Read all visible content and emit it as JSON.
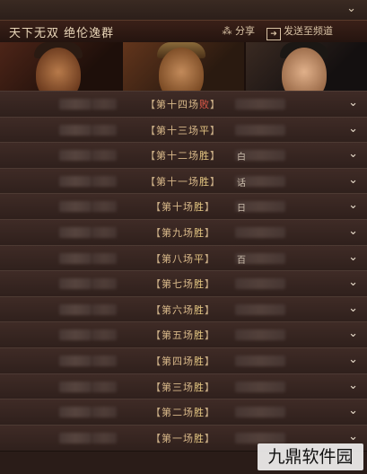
{
  "header": {
    "title": "天下无双 绝伦逸群",
    "share_label": "分享",
    "channel_label": "发送至频道"
  },
  "matches": [
    {
      "pre": "第十四场",
      "result": "败",
      "result_type": "loss",
      "opponent": ""
    },
    {
      "pre": "第十三场",
      "result": "平",
      "result_type": "draw",
      "opponent": ""
    },
    {
      "pre": "第十二场",
      "result": "胜",
      "result_type": "win",
      "opponent": "白"
    },
    {
      "pre": "第十一场",
      "result": "胜",
      "result_type": "win",
      "opponent": "话"
    },
    {
      "pre": "第十场",
      "result": "胜",
      "result_type": "win",
      "opponent": "日"
    },
    {
      "pre": "第九场",
      "result": "胜",
      "result_type": "win",
      "opponent": ""
    },
    {
      "pre": "第八场",
      "result": "平",
      "result_type": "draw",
      "opponent": "百"
    },
    {
      "pre": "第七场",
      "result": "胜",
      "result_type": "win",
      "opponent": ""
    },
    {
      "pre": "第六场",
      "result": "胜",
      "result_type": "win",
      "opponent": ""
    },
    {
      "pre": "第五场",
      "result": "胜",
      "result_type": "win",
      "opponent": ""
    },
    {
      "pre": "第四场",
      "result": "胜",
      "result_type": "win",
      "opponent": ""
    },
    {
      "pre": "第三场",
      "result": "胜",
      "result_type": "win",
      "opponent": ""
    },
    {
      "pre": "第二场",
      "result": "胜",
      "result_type": "win",
      "opponent": ""
    },
    {
      "pre": "第一场",
      "result": "胜",
      "result_type": "win",
      "opponent": ""
    }
  ],
  "watermark": "九鼎软件园",
  "colors": {
    "win": "#e7c983",
    "loss": "#e05a4a",
    "draw": "#e0c080",
    "accent": "#d9b98a"
  },
  "icons": {
    "share": "share-icon",
    "channel": "send-channel-icon",
    "expand": "chevron-down-icon"
  }
}
